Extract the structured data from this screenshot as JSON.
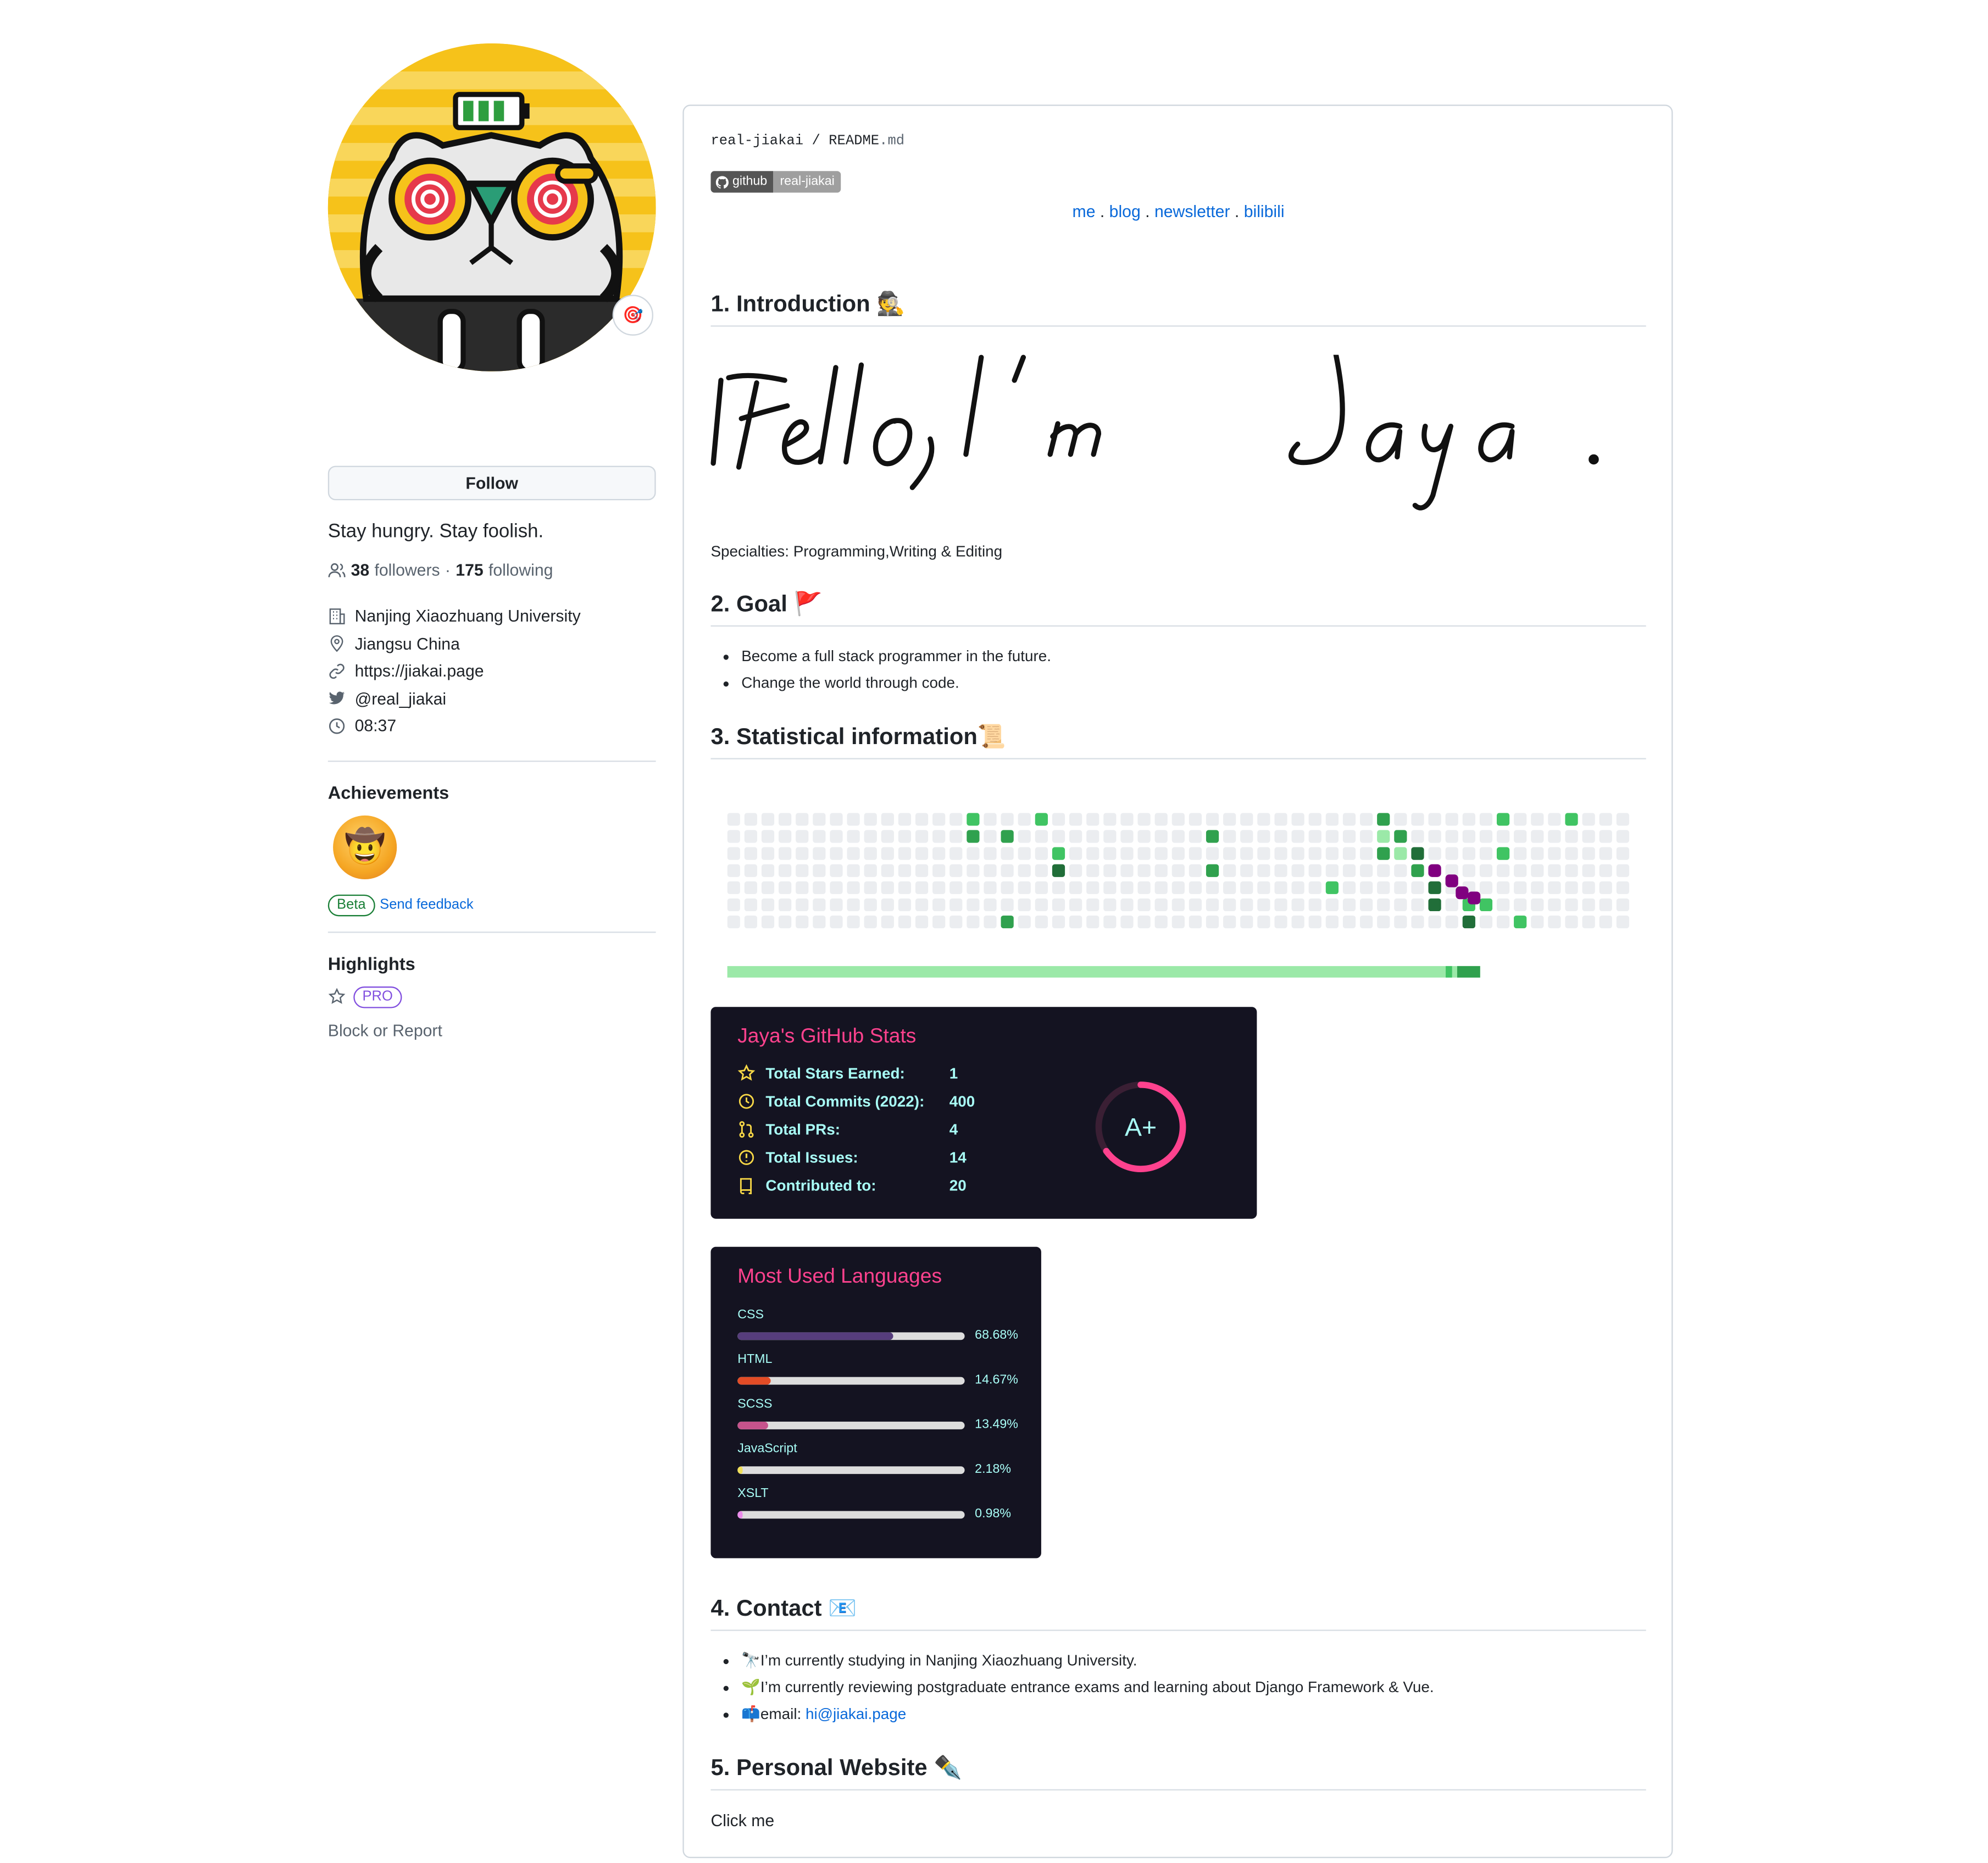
{
  "profile": {
    "follow_label": "Follow",
    "bio": "Stay hungry. Stay foolish.",
    "followers_count": "38",
    "followers_label": "followers",
    "dot": "·",
    "following_count": "175",
    "following_label": "following",
    "details": [
      {
        "icon": "organization-icon",
        "text": "Nanjing Xiaozhuang University"
      },
      {
        "icon": "location-icon",
        "text": "Jiangsu China"
      },
      {
        "icon": "link-icon",
        "text": "https://jiakai.page"
      },
      {
        "icon": "twitter-icon",
        "text": "@real_jiakai"
      },
      {
        "icon": "clock-icon",
        "text": "08:37"
      }
    ],
    "achievements_title": "Achievements",
    "beta_label": "Beta",
    "feedback_label": "Send feedback",
    "highlights_title": "Highlights",
    "pro_label": "PRO",
    "block_label": "Block or Report"
  },
  "readme": {
    "path_user": "real-jiakai",
    "path_sep": "/",
    "path_file": "README",
    "path_ext": ".md",
    "badge_left": "github",
    "badge_right": "real-jiakai",
    "nav": [
      "me",
      "blog",
      "newsletter",
      "bilibili"
    ],
    "nav_sep": " . ",
    "sec1": "1. Introduction 🕵️",
    "handwriting": "Hello, I'm Jaya.",
    "specialties": "Specialties: Programming,Writing & Editing",
    "sec2": "2. Goal 🚩",
    "goals": [
      "Become a full stack programmer in the future.",
      "Change the world through code."
    ],
    "sec3": "3. Statistical information📜",
    "sec4": "4. Contact 📧",
    "contact": [
      {
        "emoji": "🔭",
        "text": "I’m currently studying in Nanjing Xiaozhuang University."
      },
      {
        "emoji": "🌱",
        "text": "I’m currently reviewing postgraduate entrance exams and learning about Django Framework & Vue."
      },
      {
        "emoji": "📫",
        "text": "email: ",
        "link": "hi@jiakai.page"
      }
    ],
    "sec5": "5. Personal Website ✒️",
    "website_link": "Click me"
  },
  "stats_card": {
    "title": "Jaya's GitHub Stats",
    "rows": [
      {
        "icon": "star-icon",
        "label": "Total Stars Earned:",
        "value": "1"
      },
      {
        "icon": "history-icon",
        "label": "Total Commits (2022):",
        "value": "400"
      },
      {
        "icon": "pull-request-icon",
        "label": "Total PRs:",
        "value": "4"
      },
      {
        "icon": "issue-icon",
        "label": "Total Issues:",
        "value": "14"
      },
      {
        "icon": "repo-icon",
        "label": "Contributed to:",
        "value": "20"
      }
    ],
    "grade": "A+",
    "accent": "#fe428e",
    "text_color": "#a9fef7",
    "icon_color": "#f8d847",
    "bg": "#141321"
  },
  "langs_card": {
    "title": "Most Used Languages",
    "languages": [
      {
        "name": "CSS",
        "percent": 68.68,
        "label": "68.68%",
        "color": "#563d7c"
      },
      {
        "name": "HTML",
        "percent": 14.67,
        "label": "14.67%",
        "color": "#e34c26"
      },
      {
        "name": "SCSS",
        "percent": 13.49,
        "label": "13.49%",
        "color": "#c6538c"
      },
      {
        "name": "JavaScript",
        "percent": 2.18,
        "label": "2.18%",
        "color": "#f1e05a"
      },
      {
        "name": "XSLT",
        "percent": 0.98,
        "label": "0.98%",
        "color": "#EB8CEB"
      }
    ]
  }
}
